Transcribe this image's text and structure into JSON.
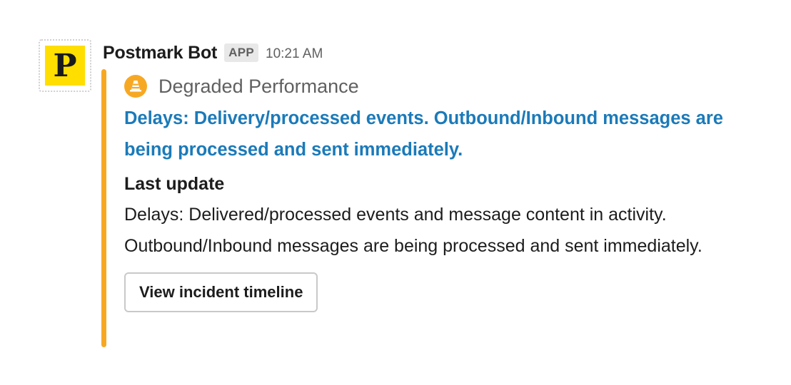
{
  "message": {
    "avatar_letter": "P",
    "sender": "Postmark Bot",
    "badge": "APP",
    "time": "10:21 AM"
  },
  "attachment": {
    "accent_color": "#f7a823",
    "status_icon": "traffic-cone-icon",
    "status_text": "Degraded Performance",
    "title": "Delays: Delivery/processed events. Outbound/Inbound messages are being processed and sent immediately.",
    "field_title": "Last update",
    "field_value": "Delays: Delivered/processed events and message content in activity. Outbound/Inbound messages are being processed and sent immediately.",
    "button_label": "View incident timeline"
  },
  "colors": {
    "link": "#1b7ab9",
    "avatar_bg": "#ffde00"
  }
}
